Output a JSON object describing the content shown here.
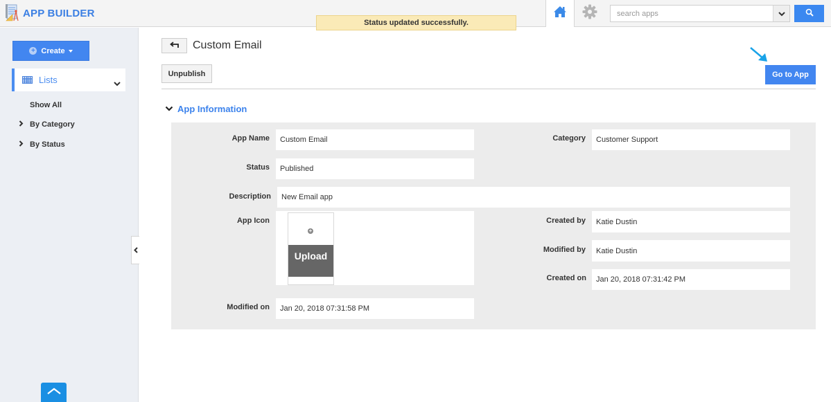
{
  "header": {
    "app_title": "APP BUILDER",
    "toast_message": "Status updated successfully.",
    "home_icon": "home-icon",
    "settings_icon": "gear-icon",
    "search": {
      "placeholder": "search apps",
      "value": ""
    },
    "search_icon": "search-icon"
  },
  "sidebar": {
    "create_label": "Create",
    "lists_label": "Lists",
    "items": [
      {
        "label": "Show All",
        "expandable": false
      },
      {
        "label": "By Category",
        "expandable": true
      },
      {
        "label": "By Status",
        "expandable": true
      }
    ]
  },
  "main": {
    "page_title": "Custom Email",
    "unpublish_label": "Unpublish",
    "go_to_app_label": "Go to App",
    "section_title": "App Information",
    "fields": {
      "app_name": {
        "label": "App Name",
        "value": "Custom Email"
      },
      "category": {
        "label": "Category",
        "value": "Customer Support"
      },
      "status": {
        "label": "Status",
        "value": "Published"
      },
      "description": {
        "label": "Description",
        "value": "New Email app"
      },
      "app_icon": {
        "label": "App Icon",
        "upload_label": "Upload"
      },
      "created_by": {
        "label": "Created by",
        "value": "Katie Dustin"
      },
      "modified_by": {
        "label": "Modified by",
        "value": "Katie Dustin"
      },
      "created_on": {
        "label": "Created on",
        "value": "Jan 20, 2018 07:31:42 PM"
      },
      "modified_on": {
        "label": "Modified on",
        "value": "Jan 20, 2018 07:31:58 PM"
      }
    }
  },
  "colors": {
    "brand": "#3b7fe3",
    "primary_button": "#4286f0",
    "toast_bg": "#faeab7",
    "sidebar_bg": "#eceff4",
    "panel_bg": "#ececec",
    "scroll_top": "#1a8fe3"
  }
}
